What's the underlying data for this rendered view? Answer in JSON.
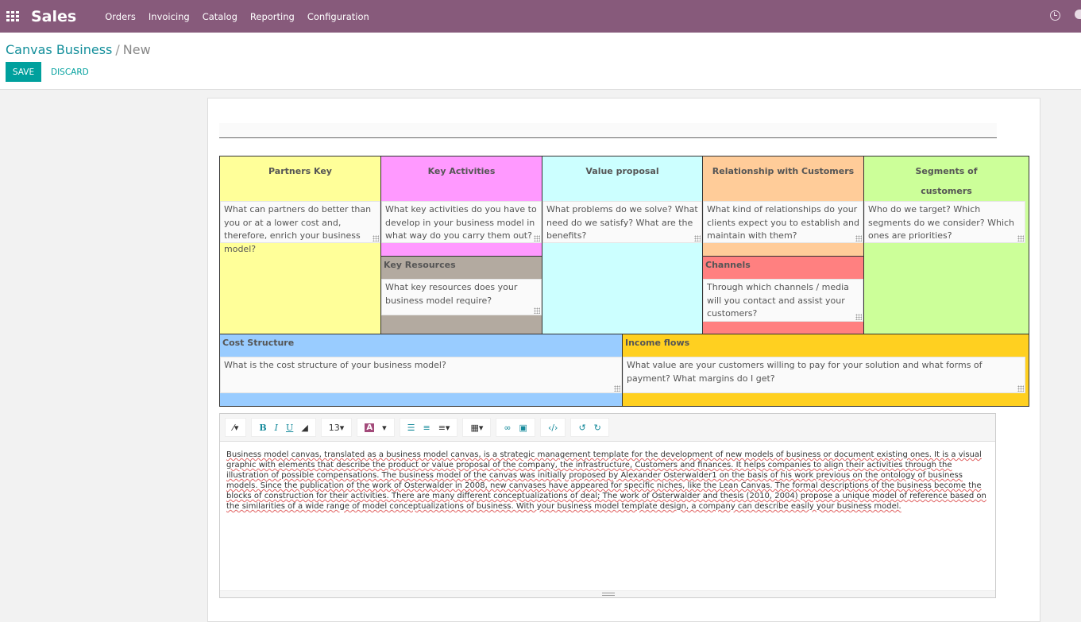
{
  "app": {
    "title": "Sales",
    "menu": [
      "Orders",
      "Invoicing",
      "Catalog",
      "Reporting",
      "Configuration"
    ]
  },
  "breadcrumb": {
    "parent": "Canvas Business",
    "separator": "/",
    "current": "New"
  },
  "buttons": {
    "save": "SAVE",
    "discard": "DISCARD"
  },
  "canvas": {
    "partners": {
      "title": "Partners Key",
      "text": "What can partners do better than you or at a lower cost and, therefore, enrich your business model?",
      "color": "#ffff99"
    },
    "activities": {
      "title": "Key Activities",
      "text": "What key activities do you have to develop in your business model in what way do you carry them out?",
      "color": "#ff99ff"
    },
    "resources": {
      "title": "Key Resources",
      "text": "What key resources does your business model require?",
      "color": "#b3aaa0"
    },
    "value": {
      "title": "Value proposal",
      "text": "What problems do we solve? What need do we satisfy? What are the benefits?",
      "color": "#ccffff"
    },
    "relationship": {
      "title": "Relationship with Customers",
      "text": "What kind of relationships do your clients expect you to establish and maintain with them?",
      "color": "#ffcc99"
    },
    "channels": {
      "title": "Channels",
      "text": "Through which channels / media will you contact and assist your customers?",
      "color": "#ff8080"
    },
    "segments": {
      "title_line1": "Segments of",
      "title_line2": "customers",
      "text": "Who do we target? Which segments do we consider? Which ones are priorities?",
      "color": "#ccff99"
    },
    "cost": {
      "title": "Cost Structure",
      "text": "What is the cost structure of your business model?",
      "color": "#99ccff"
    },
    "income": {
      "title": "Income flows",
      "text": "What value are your customers willing to pay for your solution and what forms of payment? What margins do I get?",
      "color": "#ffd020"
    }
  },
  "editor": {
    "font_size": "13",
    "body": "Business model canvas, translated as a business model canvas, is a strategic management template for the development of new models of business or document existing ones. It is a visual graphic with elements that describe the product or value proposal of the company, the infrastructure, Customers and finances. It helps companies to align their activities through the illustration of possible compensations. The business model of the canvas was initially proposed by Alexander Osterwalder1 on the basis of his work previous on the ontology of business models. Since the publication of the work of Osterwalder in 2008, new canvases have appeared for specific niches, like the Lean Canvas. The formal descriptions of the business become the blocks of construction for their activities. There are many different conceptualizations of deal; The work of Osterwalder and thesis (2010, 2004) propose a unique model of reference based on the similarities of a wide range of model conceptualizations of business. With your business model template design, a company can describe easily your business model."
  }
}
